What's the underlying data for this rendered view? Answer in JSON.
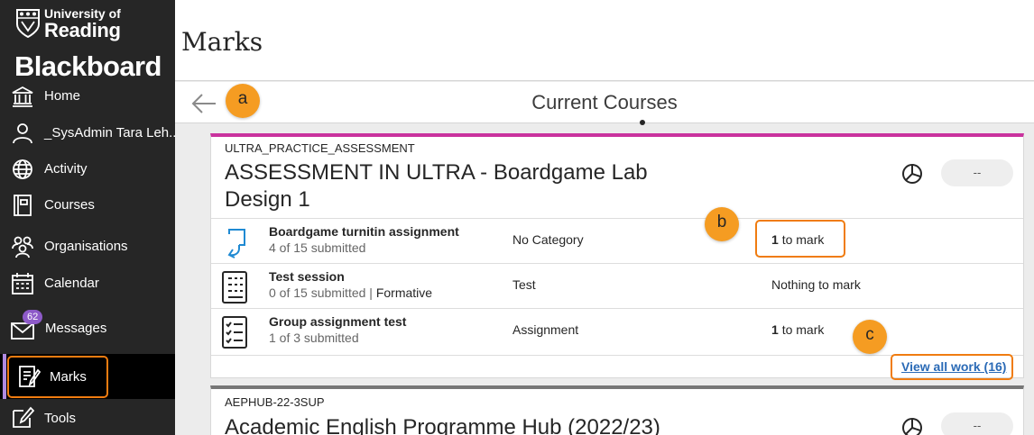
{
  "brand": {
    "university_line1": "University of",
    "university_line2": "Reading",
    "product": "Blackboard"
  },
  "sidebar": {
    "items": [
      {
        "label": "Home",
        "icon": "institution-icon"
      },
      {
        "label": "_SysAdmin Tara Leh...",
        "icon": "user-icon"
      },
      {
        "label": "Activity",
        "icon": "globe-icon"
      },
      {
        "label": "Courses",
        "icon": "book-icon"
      },
      {
        "label": "Organisations",
        "icon": "people-icon"
      },
      {
        "label": "Calendar",
        "icon": "calendar-icon"
      },
      {
        "label": "Messages",
        "icon": "envelope-icon",
        "badge": "62"
      },
      {
        "label": "Marks",
        "icon": "marks-icon",
        "active": true
      },
      {
        "label": "Tools",
        "icon": "tools-icon"
      }
    ]
  },
  "header": {
    "title": "Marks"
  },
  "subbar": {
    "title": "Current Courses"
  },
  "markers": {
    "a": "a",
    "b": "b",
    "c": "c"
  },
  "courses": [
    {
      "code": "ULTRA_PRACTICE_ASSESSMENT",
      "title": "ASSESSMENT IN ULTRA - Boardgame Lab Design 1",
      "grade": "--",
      "items": [
        {
          "name": "Boardgame turnitin assignment",
          "submitted": "4 of 15 submitted",
          "extra": "",
          "category": "No Category",
          "mark_count": "1",
          "mark_text": "to mark",
          "icon": "turnitin-icon"
        },
        {
          "name": "Test session",
          "submitted": "0 of 15 submitted",
          "extra": "Formative",
          "category": "Test",
          "mark_count": "",
          "mark_text": "Nothing to mark",
          "icon": "test-icon"
        },
        {
          "name": "Group assignment test",
          "submitted": "1 of 3 submitted",
          "extra": "",
          "category": "Assignment",
          "mark_count": "1",
          "mark_text": "to mark",
          "icon": "assignment-icon"
        }
      ],
      "view_all": "View all work (16)"
    },
    {
      "code": "AEPHUB-22-3SUP",
      "title": "Academic English Programme Hub (2022/23)",
      "grade": "--"
    }
  ],
  "colors": {
    "sidebar_bg": "#262626",
    "accent_magenta": "#c9329e",
    "highlight_orange": "#f07c10",
    "marker_orange": "#f59c22",
    "link_blue": "#2a6ab6",
    "badge_purple": "#8d5ac8"
  }
}
